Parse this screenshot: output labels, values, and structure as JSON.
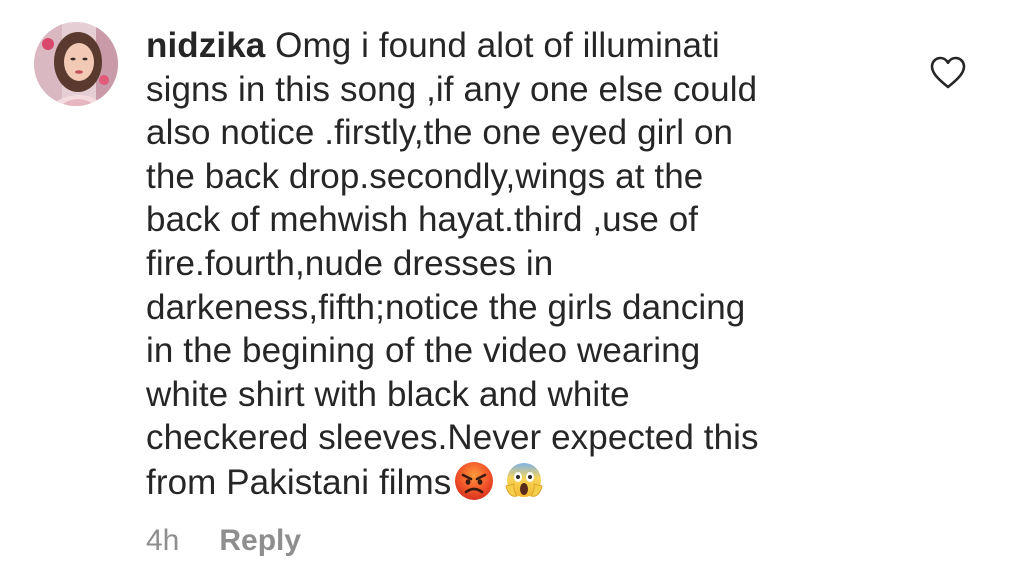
{
  "comment": {
    "username": "nidzika",
    "text_lines": [
      " Omg i found alot of illuminati",
      "signs in this song ,if any one else could",
      "also notice .firstly,the one eyed girl on",
      "the back drop.secondly,wings at the",
      "back of mehwish hayat.third ,use of",
      "fire.fourth,nude dresses in",
      "darkeness,fifth;notice the girls dancing",
      "in the begining of the video wearing",
      "white shirt with black and white",
      "checkered sleeves.Never expected this",
      "from Pakistani films"
    ],
    "emojis": [
      "angry-face-emoji",
      "screaming-face-emoji"
    ],
    "time": "4h",
    "reply_label": "Reply",
    "like_icon": "heart-outline-icon"
  },
  "colors": {
    "text": "#262626",
    "muted": "#8e8e8e"
  }
}
